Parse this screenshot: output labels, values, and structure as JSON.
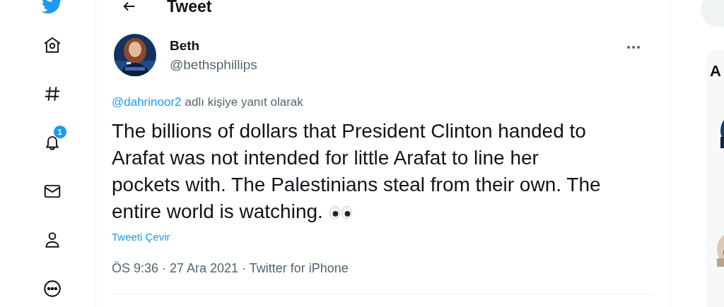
{
  "nav": {
    "items": [
      {
        "kind": "home"
      },
      {
        "kind": "explore"
      },
      {
        "kind": "notifications",
        "badge": "1"
      },
      {
        "kind": "messages"
      },
      {
        "kind": "profile"
      },
      {
        "kind": "more"
      }
    ]
  },
  "header": {
    "title": "Tweet"
  },
  "tweet": {
    "author": {
      "name": "Beth",
      "handle": "@bethsphillips"
    },
    "reply_to": {
      "mention": "@dahrinoor2",
      "suffix": "adlı kişiye yanıt olarak"
    },
    "text": "The billions of dollars that President Clinton handed to Arafat was not intended for little Arafat to line her pockets with. The Palestinians steal from their own. The entire world is watching.",
    "translate": "Tweeti Çevir",
    "meta": "ÖS 9:36 · 27 Ara 2021 · Twitter for iPhone"
  },
  "sidebar": {
    "card_title": "A"
  }
}
